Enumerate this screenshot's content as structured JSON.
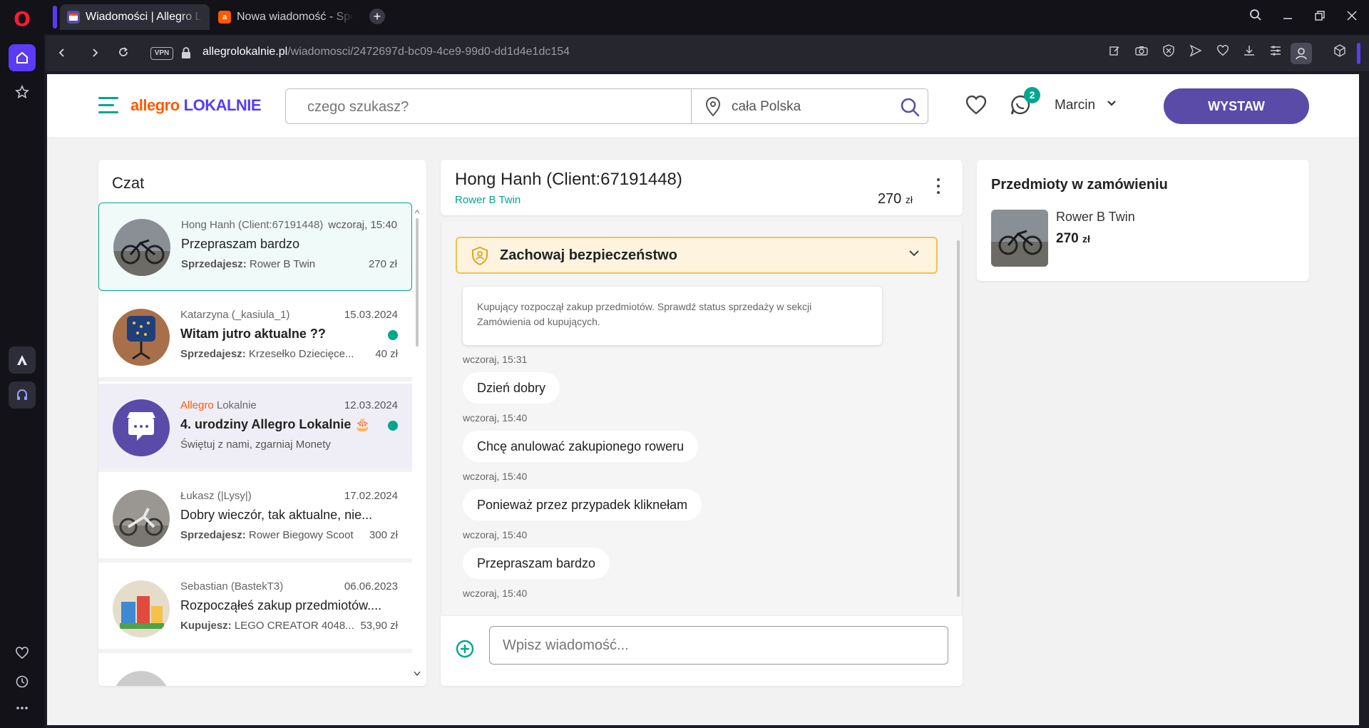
{
  "browser": {
    "tabs": [
      {
        "label": "Wiadomości | Allegro Lokalnie",
        "active": true
      },
      {
        "label": "Nowa wiadomość - Społeczność",
        "active": false
      }
    ],
    "vpn_label": "VPN",
    "url_domain": "allegrolokalnie.pl",
    "url_path": "/wiadomosci/2472697d-bc09-4ce9-99d0-dd1d4e1dc154"
  },
  "header": {
    "logo_allegro": "allegro",
    "logo_lokalnie": "LOKALNIE",
    "search_placeholder": "czego szukasz?",
    "location": "cała Polska",
    "messages_count": "2",
    "user_name": "Marcin",
    "cta_label": "WYSTAW"
  },
  "chat_list": {
    "title": "Czat",
    "conversations": [
      {
        "who": "Hong Hanh (Client:67191448)",
        "when": "wczoraj, 15:40",
        "message": "Przepraszam bardzo",
        "role": "Sprzedajesz:",
        "item": "Rower B Twin",
        "price": "270 zł",
        "selected": true
      },
      {
        "who": "Katarzyna (_kasiula_1)",
        "when": "15.03.2024",
        "message": "Witam jutro aktualne ??",
        "role": "Sprzedajesz:",
        "item": "Krzesełko Dziecięce...",
        "price": "40 zł",
        "unread": true
      },
      {
        "who_accent": "Allegro",
        "who": "Lokalnie",
        "when": "12.03.2024",
        "message": "4. urodziny Allegro Lokalnie 🎂",
        "sub": "Świętuj z nami, zgarniaj Monety",
        "unread": true
      },
      {
        "who": "Łukasz (|Lysy|)",
        "when": "17.02.2024",
        "message": "Dobry wieczór, tak aktualne, nie...",
        "role": "Sprzedajesz:",
        "item": "Rower Biegowy Scoot",
        "price": "300 zł"
      },
      {
        "who": "Sebastian (BastekT3)",
        "when": "06.06.2023",
        "message": "Rozpocząłeś zakup przedmiotów....",
        "role": "Kupujesz:",
        "item": "LEGO CREATOR 4048...",
        "price": "53,90 zł"
      }
    ]
  },
  "conversation": {
    "name": "Hong Hanh (Client:67191448)",
    "item": "Rower B Twin",
    "price": "270",
    "currency": "zł",
    "safety_label": "Zachowaj bezpieczeństwo",
    "system_message": "Kupujący rozpoczął zakup przedmiotów. Sprawdź status sprzedaży w sekcji Zamówienia od kupujących.",
    "messages": [
      {
        "time": "wczoraj, 15:31",
        "text": "Dzień dobry"
      },
      {
        "time": "wczoraj, 15:40",
        "text": "Chcę anulować zakupionego roweru"
      },
      {
        "time": "wczoraj, 15:40",
        "text": "Ponieważ przez przypadek kliknełam"
      },
      {
        "time": "wczoraj, 15:40",
        "text": "Przepraszam bardzo"
      },
      {
        "time": "wczoraj, 15:40",
        "text": ""
      }
    ],
    "input_placeholder": "Wpisz wiadomość..."
  },
  "order": {
    "title": "Przedmioty w zamówieniu",
    "item_name": "Rower B Twin",
    "price": "270",
    "currency": "zł"
  },
  "colors": {
    "accent_teal": "#00a790",
    "brand_purple": "#5b4ba8",
    "brand_orange": "#ff5a00",
    "opera_red": "#ff1b2d"
  }
}
